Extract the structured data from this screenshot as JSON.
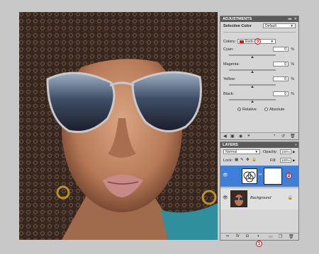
{
  "adjustments": {
    "title": "ADJUSTMENTS",
    "panel_name": "Selective Color",
    "preset": "Default",
    "colors_label": "Colors:",
    "colors_value": "Reds",
    "sliders": [
      {
        "label": "Cyan:",
        "value": "0",
        "unit": "%"
      },
      {
        "label": "Magenta:",
        "value": "0",
        "unit": "%"
      },
      {
        "label": "Yellow:",
        "value": "0",
        "unit": "%"
      },
      {
        "label": "Black:",
        "value": "0",
        "unit": "%"
      }
    ],
    "method_relative": "Relative",
    "method_absolute": "Absolute",
    "selected_method": "relative",
    "reds_swatch_color": "#e01010"
  },
  "layers": {
    "title": "LAYERS",
    "blend_mode": "Normal",
    "opacity_label": "Opacity:",
    "opacity_value": "100%",
    "lock_label": "Lock:",
    "fill_label": "Fill:",
    "fill_value": "100%",
    "list": [
      {
        "name": "",
        "type": "adjustment",
        "selected": true
      },
      {
        "name": "Background",
        "type": "image",
        "selected": false
      }
    ],
    "selection_color": "#3d7fd9"
  },
  "annotations": {
    "badge_colors": "3",
    "badge_mask": "2",
    "badge_new_adjustment": "1",
    "badge_color": "#d01010"
  }
}
